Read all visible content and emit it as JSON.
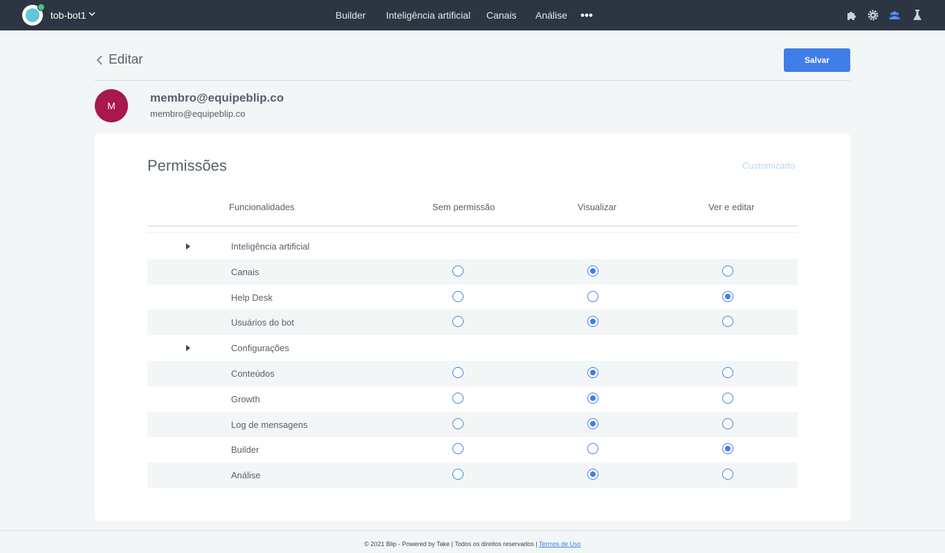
{
  "topbar": {
    "bot_name": "tob-bot1",
    "nav": [
      "Builder",
      "Inteligência artificial",
      "Canais",
      "Análise"
    ],
    "icons": [
      "puzzle-icon",
      "gear-icon",
      "team-icon",
      "flask-icon"
    ]
  },
  "header": {
    "title": "Editar",
    "save_label": "Salvar"
  },
  "member": {
    "initial": "M",
    "name": "membro@equipeblip.co",
    "email": "membro@equipeblip.co"
  },
  "permissions": {
    "title": "Permissões",
    "custom_label": "Customizado",
    "columns": {
      "feature": "Funcionalidades",
      "none": "Sem permissão",
      "view": "Visualizar",
      "edit": "Ver e editar"
    },
    "rows": [
      {
        "label": "Inteligência artificial",
        "group": true
      },
      {
        "label": "Canais",
        "value": "view"
      },
      {
        "label": "Help Desk",
        "value": "edit"
      },
      {
        "label": "Usuários do bot",
        "value": "view"
      },
      {
        "label": "Configurações",
        "group": true
      },
      {
        "label": "Conteúdos",
        "value": "view"
      },
      {
        "label": "Growth",
        "value": "view"
      },
      {
        "label": "Log de mensagens",
        "value": "view"
      },
      {
        "label": "Builder",
        "value": "edit"
      },
      {
        "label": "Análise",
        "value": "view"
      }
    ]
  },
  "footer": {
    "text": "© 2021 Blip - Powered by Take | Todos os direitos reservados | ",
    "terms": "Termos de Uso"
  },
  "colors": {
    "topbar": "#2c3542",
    "accent": "#3f7de8",
    "avatar": "#a8174e"
  }
}
